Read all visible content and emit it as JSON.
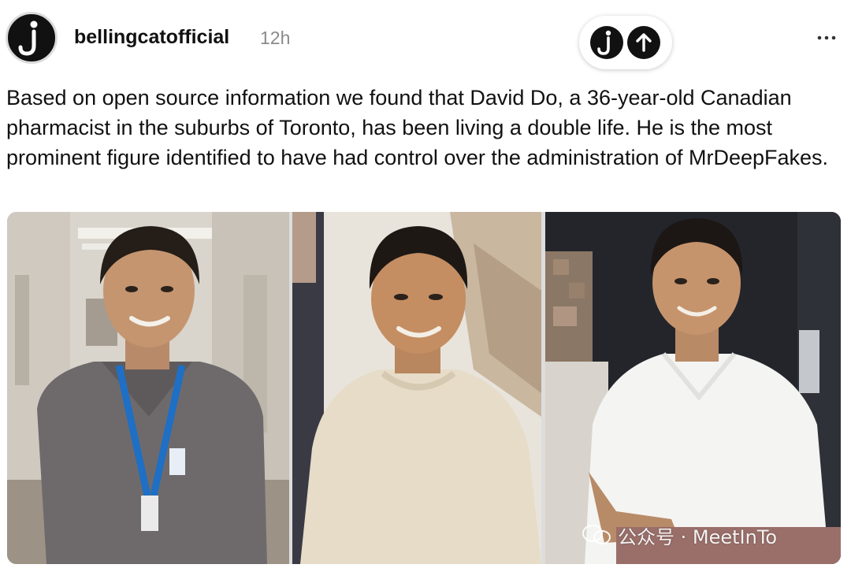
{
  "post": {
    "author": "bellingcatofficial",
    "time": "12h",
    "text": "Based on open source information we found that David Do, a 36-year-old Canadian pharmacist in the suburbs of Toronto, has been living a double life. He is the most prominent figure identified to have had control over the administration of MrDeepFakes."
  },
  "icons": {
    "avatar": "bellingcat-logo-icon",
    "follow": "bellingcat-logo-icon",
    "share": "arrow-up-icon",
    "more": "more-horizontal-icon"
  },
  "watermark": {
    "text": "公众号 · MeetInTo"
  },
  "colors": {
    "text": "#111111",
    "muted": "#8a8a8a",
    "lanyard": "#1f6fc4"
  }
}
